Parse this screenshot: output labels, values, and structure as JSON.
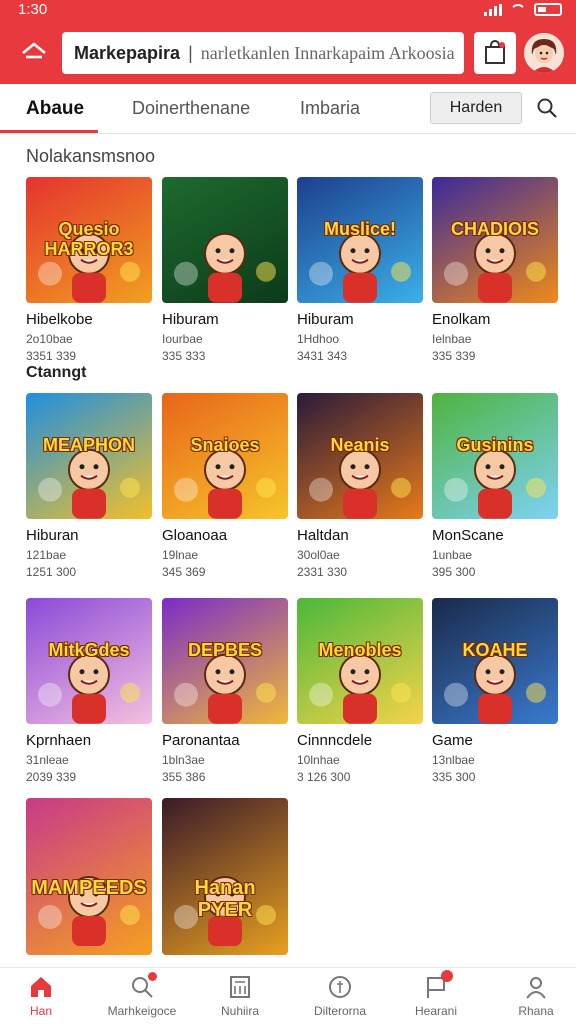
{
  "status": {
    "time": "1:30"
  },
  "appbar": {
    "brand": "Markepapira",
    "search_placeholder": "narletkanlen Innarkapaim Arkoosia"
  },
  "tabs": [
    {
      "label": "Abaue",
      "active": true
    },
    {
      "label": "Doinerthenane",
      "active": false
    },
    {
      "label": "Imbaria",
      "active": false
    }
  ],
  "tab_button": "Harden",
  "sections": [
    {
      "title": "Nolakansmsnoo"
    },
    {
      "title": "Ctanngt"
    }
  ],
  "cards": [
    {
      "thumb_title": "Quesio HARROR3",
      "name": "Hibelkobe",
      "meta1": "2o10bae",
      "meta2": "3351 339",
      "colors": [
        "#e5332f",
        "#f0a020"
      ],
      "icon": "kids-bear-icon"
    },
    {
      "thumb_title": "",
      "name": "Hiburam",
      "meta1": "Iourbae",
      "meta2": "335 333",
      "colors": [
        "#1d6b2e",
        "#0d3a1a"
      ],
      "icon": "boy-ball-icon"
    },
    {
      "thumb_title": "Muslice!",
      "name": "Hiburam",
      "meta1": "1Hdhoo",
      "meta2": "3431 343",
      "colors": [
        "#1d3f8f",
        "#3bb0e8"
      ],
      "icon": "bubbles-icon"
    },
    {
      "thumb_title": "CHADIOIS",
      "name": "Enolkam",
      "meta1": "Ielnbae",
      "meta2": "335 339",
      "colors": [
        "#3a2a9a",
        "#f08a1a"
      ],
      "icon": "carnival-icon"
    },
    {
      "thumb_title": "MEAPHON",
      "name": "Hiburan",
      "meta1": "121bae",
      "meta2": "1251 300",
      "colors": [
        "#1e8fe0",
        "#f2c02a"
      ],
      "icon": "red-bear-icon"
    },
    {
      "thumb_title": "Snaioes",
      "name": "Gloanoaa",
      "meta1": "19lnae",
      "meta2": "345 369",
      "colors": [
        "#e8651a",
        "#f7c52a"
      ],
      "icon": "dino-icon"
    },
    {
      "thumb_title": "Neanis",
      "name": "Haltdan",
      "meta1": "30ol0ae",
      "meta2": "2331 330",
      "colors": [
        "#2a1a3a",
        "#e87a1a"
      ],
      "icon": "explosion-icon"
    },
    {
      "thumb_title": "Gusinins",
      "name": "MonScane",
      "meta1": "1unbae",
      "meta2": "395 300",
      "colors": [
        "#4fb33e",
        "#7ed2f5"
      ],
      "icon": "kids-run-icon"
    },
    {
      "thumb_title": "MitkGdes",
      "name": "Kprnhaen",
      "meta1": "31nleae",
      "meta2": "2039 339",
      "colors": [
        "#8a4ad8",
        "#f5c0e0"
      ],
      "icon": "kids-group-icon"
    },
    {
      "thumb_title": "DEPBES",
      "name": "Paronantaa",
      "meta1": "1bln3ae",
      "meta2": "355 386",
      "colors": [
        "#7a2cc8",
        "#f0b83a"
      ],
      "icon": "girl-monsters-icon"
    },
    {
      "thumb_title": "Menobles",
      "name": "Cinnncdele",
      "meta1": "10lnhae",
      "meta2": "3 126 300",
      "colors": [
        "#4cb83a",
        "#f5d34a"
      ],
      "icon": "kids-walk-icon"
    },
    {
      "thumb_title": "KOAHE",
      "name": "Game",
      "meta1": "13nlbae",
      "meta2": "335 300",
      "colors": [
        "#1a2a4a",
        "#3a7acf"
      ],
      "icon": "tunnel-icon"
    },
    {
      "thumb_title": "MAMPEEDS",
      "name": "",
      "meta1": "",
      "meta2": "",
      "colors": [
        "#c83a8a",
        "#f5a020"
      ],
      "icon": "car-racer-icon"
    },
    {
      "thumb_title": "Hanan PYER",
      "name": "",
      "meta1": "",
      "meta2": "",
      "colors": [
        "#3a1a2a",
        "#e8a020"
      ],
      "icon": "hero-icon"
    }
  ],
  "bottom_nav": [
    {
      "label": "Han",
      "active": true
    },
    {
      "label": "Marhkeigoce",
      "active": false
    },
    {
      "label": "Nuhiira",
      "active": false
    },
    {
      "label": "Dilterorna",
      "active": false
    },
    {
      "label": "Hearani",
      "active": false
    },
    {
      "label": "Rhana",
      "active": false
    }
  ],
  "colors": {
    "accent": "#e8393f",
    "text": "#1c1c1c",
    "muted": "#666666"
  }
}
